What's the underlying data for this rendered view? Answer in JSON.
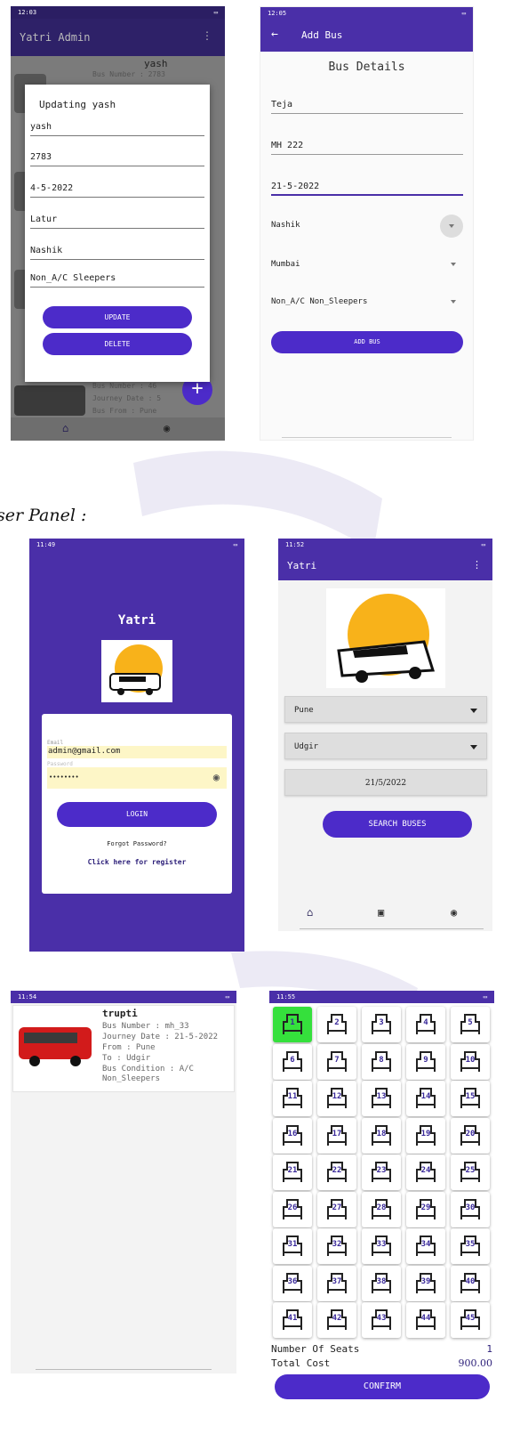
{
  "section_heading": "ser Panel :",
  "phone_admin_update": {
    "status_time": "12:03",
    "app_title": "Yatri Admin",
    "bg_item_name": "yash",
    "bg_item_bus_number": "Bus Number   : 2783",
    "bg_item3_bus_number": "Bus Number   : 46",
    "bg_item3_journey": "Journey Date   : 5",
    "bg_item3_from": "Bus From      : Pune",
    "dialog_title": "Updating yash",
    "fields": [
      "yash",
      "2783",
      "4-5-2022",
      "Latur",
      "Nashik",
      "Non_A/C Sleepers"
    ],
    "update_label": "UPDATE",
    "delete_label": "DELETE",
    "fab_icon": "plus-icon"
  },
  "phone_add_bus": {
    "status_time": "12:05",
    "screen_title": "Add Bus",
    "heading": "Bus Details",
    "fields": [
      "Teja",
      "MH 222",
      "21-5-2022"
    ],
    "spinners": [
      "Nashik",
      "Mumbai",
      "Non_A/C Non_Sleepers"
    ],
    "add_label": "ADD BUS"
  },
  "phone_login": {
    "status_time": "11:49",
    "app_name": "Yatri",
    "email_label": "Email",
    "email_value": "admin@gmail.com",
    "password_label": "Password",
    "password_value": "••••••••",
    "login_label": "LOGIN",
    "forgot_label": "Forgot Password?",
    "register_label": "Click here for register"
  },
  "phone_search": {
    "status_time": "11:52",
    "app_name": "Yatri",
    "from_value": "Pune",
    "to_value": "Udgir",
    "date_value": "21/5/2022",
    "search_label": "SEARCH BUSES"
  },
  "phone_results": {
    "status_time": "11:54",
    "bus_name": "trupti",
    "bus_number": "Bus Number : mh_33",
    "journey_date": "Journey Date : 21-5-2022",
    "from": "From : Pune",
    "to": "To : Udgir",
    "condition_1": "Bus Condition : A/C",
    "condition_2": "Non_Sleepers"
  },
  "phone_seats": {
    "status_time": "11:55",
    "seats": [
      "1",
      "2",
      "3",
      "4",
      "5",
      "6",
      "7",
      "8",
      "9",
      "10",
      "11",
      "12",
      "13",
      "14",
      "15",
      "16",
      "17",
      "18",
      "19",
      "20",
      "21",
      "22",
      "23",
      "24",
      "25",
      "26",
      "27",
      "28",
      "29",
      "30",
      "31",
      "32",
      "33",
      "34",
      "35",
      "36",
      "37",
      "38",
      "39",
      "40",
      "41",
      "42",
      "43",
      "44",
      "45"
    ],
    "selected_seat": "1",
    "seats_label": "Number Of Seats",
    "seats_value": "1",
    "cost_label": "Total Cost",
    "cost_value": "900.00",
    "confirm_label": "CONFIRM"
  },
  "colors": {
    "primary": "#4a2fa8",
    "button": "#4c2bc9",
    "selected_seat": "#35e03c",
    "sun": "#f8b21a"
  }
}
